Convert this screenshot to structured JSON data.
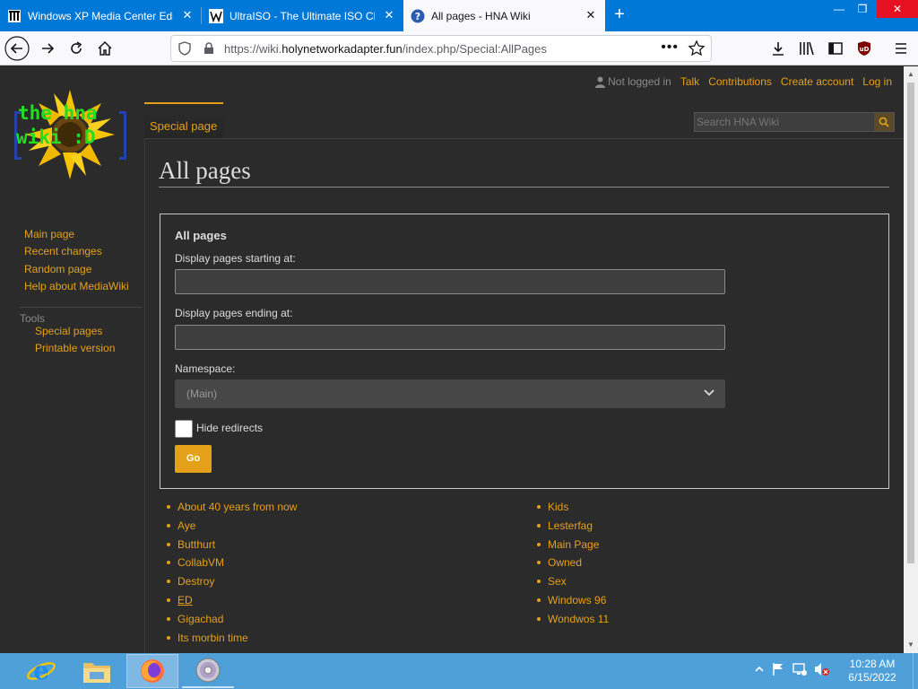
{
  "browser": {
    "tabs": [
      {
        "title": "Windows XP Media Center Edition",
        "icon": "archive-icon"
      },
      {
        "title": "UltraISO - The Ultimate ISO CD",
        "icon": "wiki-w-icon"
      },
      {
        "title": "All pages - HNA Wiki",
        "icon": "help-circle-icon"
      }
    ],
    "url": {
      "scheme": "https://wiki.",
      "domain": "holynetworkadapter.fun",
      "path": "/index.php/Special:AllPages"
    },
    "more": "•••"
  },
  "wiki": {
    "logo_text_line1": "the hna",
    "logo_text_line2": "wiki :D",
    "personal": {
      "not_logged_in": "Not logged in",
      "talk": "Talk",
      "contributions": "Contributions",
      "create_account": "Create account",
      "login": "Log in"
    },
    "namespace_tab": "Special page",
    "search_placeholder": "Search HNA Wiki",
    "page_title": "All pages",
    "nav": [
      "Main page",
      "Recent changes",
      "Random page",
      "Help about MediaWiki"
    ],
    "tools_heading": "Tools",
    "tools": [
      "Special pages",
      "Printable version"
    ],
    "form": {
      "legend": "All pages",
      "from_label": "Display pages starting at:",
      "from_value": "",
      "to_label": "Display pages ending at:",
      "to_value": "",
      "namespace_label": "Namespace:",
      "namespace_value": "(Main)",
      "hide_redirects_label": "Hide redirects",
      "hide_redirects_checked": false,
      "go_label": "Go"
    },
    "pages_col1": [
      "About 40 years from now",
      "Aye",
      "Butthurt",
      "CollabVM",
      "Destroy",
      "ED",
      "Gigachad",
      "Its morbin time"
    ],
    "pages_col2": [
      "Kids",
      "Lesterfag",
      "Main Page",
      "Owned",
      "Sex",
      "Windows 96",
      "Wondwos 11"
    ],
    "accent_color": "#e5a01a"
  },
  "taskbar": {
    "apps": [
      "internet-explorer-icon",
      "file-explorer-icon",
      "firefox-icon",
      "disc-icon"
    ],
    "time": "10:28 AM",
    "date": "6/15/2022"
  }
}
